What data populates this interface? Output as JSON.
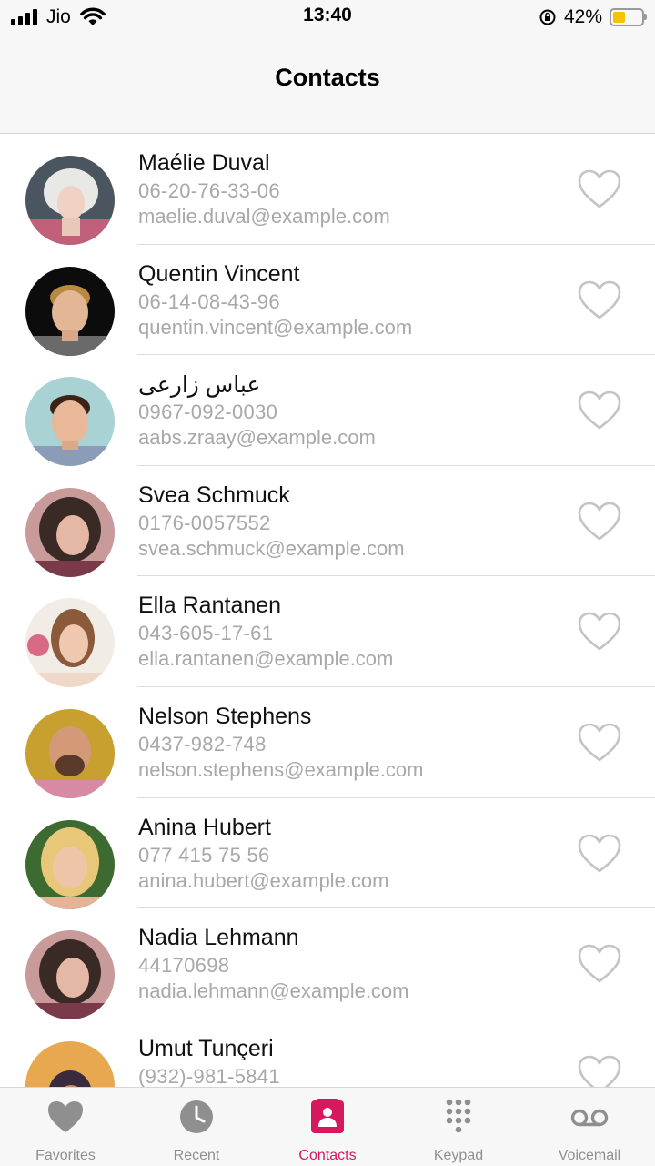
{
  "status_bar": {
    "carrier": "Jio",
    "time": "13:40",
    "battery_percent": "42%",
    "battery_level": 0.42,
    "icons": [
      "signal-icon",
      "wifi-icon",
      "rotation-lock-icon",
      "battery-icon"
    ]
  },
  "nav": {
    "title": "Contacts"
  },
  "contacts": [
    {
      "name": "Maélie Duval",
      "phone": "06-20-76-33-06",
      "email": "maelie.duval@example.com",
      "favorite": false
    },
    {
      "name": "Quentin Vincent",
      "phone": "06-14-08-43-96",
      "email": "quentin.vincent@example.com",
      "favorite": false
    },
    {
      "name": "عباس زارعی",
      "phone": "0967-092-0030",
      "email": "aabs.zraay@example.com",
      "favorite": false
    },
    {
      "name": "Svea Schmuck",
      "phone": "0176-0057552",
      "email": "svea.schmuck@example.com",
      "favorite": false
    },
    {
      "name": "Ella Rantanen",
      "phone": "043-605-17-61",
      "email": "ella.rantanen@example.com",
      "favorite": false
    },
    {
      "name": "Nelson Stephens",
      "phone": "0437-982-748",
      "email": "nelson.stephens@example.com",
      "favorite": false
    },
    {
      "name": "Anina Hubert",
      "phone": "077 415 75 56",
      "email": "anina.hubert@example.com",
      "favorite": false
    },
    {
      "name": "Nadia Lehmann",
      "phone": "44170698",
      "email": "nadia.lehmann@example.com",
      "favorite": false
    },
    {
      "name": "Umut Tunçeri",
      "phone": "(932)-981-5841",
      "email": "",
      "favorite": false
    }
  ],
  "tabs": [
    {
      "label": "Favorites",
      "icon": "heart-icon",
      "active": false
    },
    {
      "label": "Recent",
      "icon": "clock-icon",
      "active": false
    },
    {
      "label": "Contacts",
      "icon": "contacts-icon",
      "active": true
    },
    {
      "label": "Keypad",
      "icon": "keypad-icon",
      "active": false
    },
    {
      "label": "Voicemail",
      "icon": "voicemail-icon",
      "active": false
    }
  ],
  "colors": {
    "accent": "#d6195f",
    "inactive_tab": "#8f8f8f",
    "secondary_text": "#a8a8a8",
    "heart_outline": "#c4c4c4",
    "battery_fill": "#f5c400"
  }
}
